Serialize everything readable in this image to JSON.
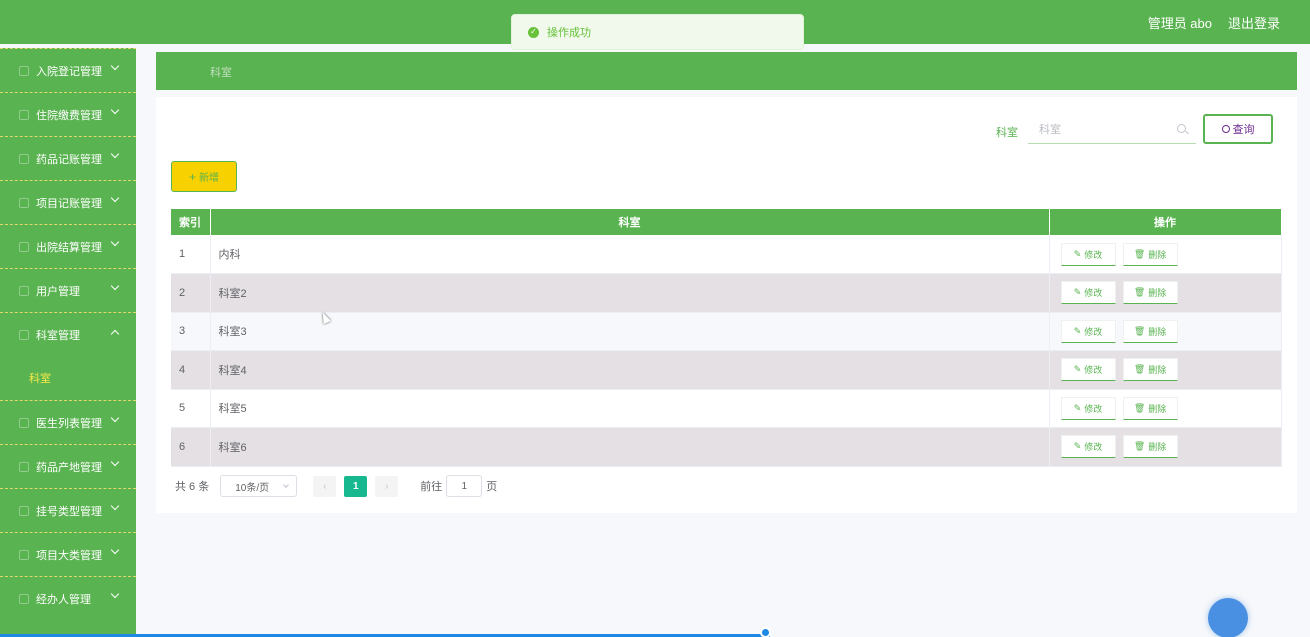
{
  "header": {
    "user_label": "管理员 abo",
    "logout_label": "退出登录"
  },
  "toast": {
    "message": "操作成功"
  },
  "sidebar": {
    "items": [
      {
        "label": "入院登记管理",
        "expanded": false
      },
      {
        "label": "住院缴费管理",
        "expanded": false
      },
      {
        "label": "药品记账管理",
        "expanded": false
      },
      {
        "label": "项目记账管理",
        "expanded": false
      },
      {
        "label": "出院结算管理",
        "expanded": false
      },
      {
        "label": "用户管理",
        "expanded": false
      },
      {
        "label": "科室管理",
        "expanded": true
      },
      {
        "label": "医生列表管理",
        "expanded": false
      },
      {
        "label": "药品产地管理",
        "expanded": false
      },
      {
        "label": "挂号类型管理",
        "expanded": false
      },
      {
        "label": "项目大类管理",
        "expanded": false
      },
      {
        "label": "经办人管理",
        "expanded": false
      }
    ],
    "sub_item": "科室"
  },
  "breadcrumb": {
    "current": "科室"
  },
  "search": {
    "label": "科室",
    "placeholder": "科室",
    "value": "",
    "button_label": "查询"
  },
  "toolbar": {
    "add_label": "新增"
  },
  "table": {
    "headers": [
      "索引",
      "科室",
      "操作"
    ],
    "rows": [
      {
        "index": "1",
        "name": "内科"
      },
      {
        "index": "2",
        "name": "科室2"
      },
      {
        "index": "3",
        "name": "科室3"
      },
      {
        "index": "4",
        "name": "科室4"
      },
      {
        "index": "5",
        "name": "科室5"
      },
      {
        "index": "6",
        "name": "科室6"
      }
    ],
    "edit_label": "修改",
    "delete_label": "删除"
  },
  "pagination": {
    "total_text": "共 6 条",
    "page_size": "10条/页",
    "current_page": "1",
    "goto_label": "前往",
    "goto_value": "1",
    "page_suffix": "页"
  },
  "colors": {
    "primary": "#59b350",
    "add_button": "#f7d100",
    "active_page": "#17b890"
  }
}
